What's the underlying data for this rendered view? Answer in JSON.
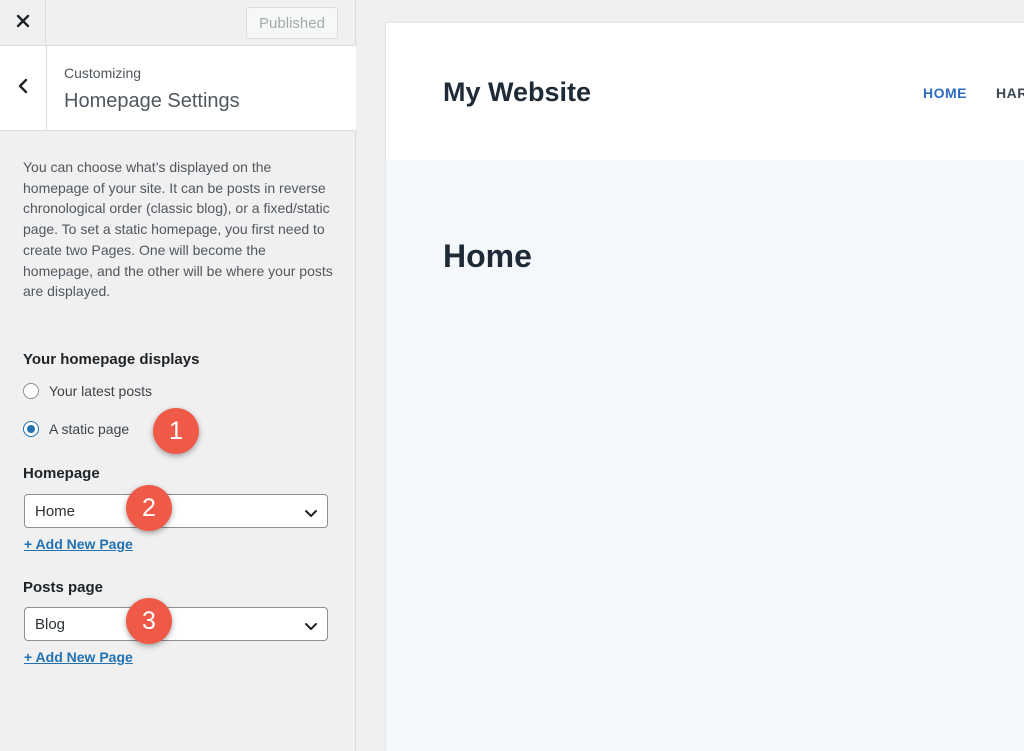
{
  "topbar": {
    "close_icon": "close-x-icon",
    "publish_label": "Published"
  },
  "section": {
    "back_icon": "chevron-left-icon",
    "breadcrumb": "Customizing",
    "title": "Homepage Settings"
  },
  "description": "You can choose what’s displayed on the homepage of your site. It can be posts in reverse chronological order (classic blog), or a fixed/static page. To set a static homepage, you first need to create two Pages. One will become the homepage, and the other will be where your posts are displayed.",
  "homepage_displays": {
    "label": "Your homepage displays",
    "options": [
      {
        "label": "Your latest posts",
        "checked": false
      },
      {
        "label": "A static page",
        "checked": true
      }
    ]
  },
  "homepage_select": {
    "label": "Homepage",
    "value": "Home",
    "add_link": "+ Add New Page"
  },
  "posts_select": {
    "label": "Posts page",
    "value": "Blog",
    "add_link": "+ Add New Page"
  },
  "markers": [
    "1",
    "2",
    "3"
  ],
  "preview": {
    "site_title": "My Website",
    "nav": [
      "HOME",
      "HAR"
    ],
    "page_heading": "Home"
  },
  "colors": {
    "accent": "#2271b1",
    "marker": "#ef5947",
    "nav_active": "#2e6bbd"
  }
}
